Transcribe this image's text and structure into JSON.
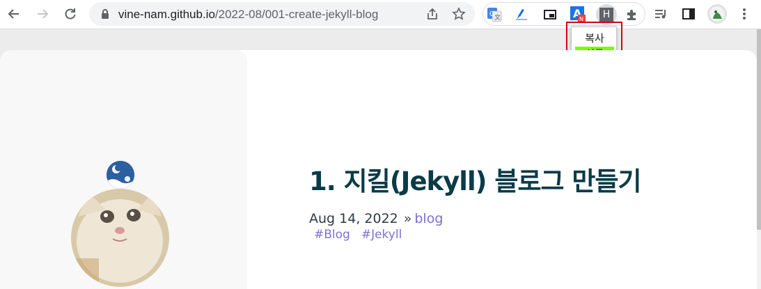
{
  "browser": {
    "url_host": "vine-nam.github.io",
    "url_path": "/2022-08/001-create-jekyll-blog",
    "extensions": [
      {
        "name": "google-translate"
      },
      {
        "name": "extension-pen"
      },
      {
        "name": "picture-in-picture"
      },
      {
        "name": "extension-a",
        "badge": "N"
      },
      {
        "name": "extension-h",
        "letter": "H"
      }
    ]
  },
  "popup": {
    "title": "복사",
    "status": "성공",
    "status_color": "#7cfc00",
    "outline_color": "#d0021b"
  },
  "post": {
    "title": "1. 지킬(Jekyll) 블로그 만들기",
    "date": "Aug 14, 2022",
    "separator": "»",
    "category": "blog",
    "tags": [
      "#Blog",
      "#Jekyll"
    ]
  },
  "colors": {
    "title": "#0b3b47",
    "link": "#7f6fd1"
  }
}
